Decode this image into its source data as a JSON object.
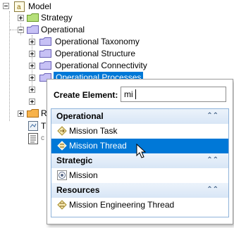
{
  "tree": {
    "root": "Model",
    "items": [
      {
        "label": "Strategy"
      },
      {
        "label": "Operational"
      },
      {
        "label": "Operational Taxonomy"
      },
      {
        "label": "Operational Structure"
      },
      {
        "label": "Operational Connectivity"
      },
      {
        "label": "Operational Processes"
      },
      {
        "label": "R"
      },
      {
        "label": "T"
      },
      {
        "label": "c"
      }
    ]
  },
  "popup": {
    "create_label": "Create Element:",
    "search_value": "mi",
    "groups": [
      {
        "label": "Operational",
        "collapse_icon": "double-chevron-up-icon",
        "items": [
          {
            "label": "Mission Task",
            "icon": "mission-task-icon"
          },
          {
            "label": "Mission Thread",
            "icon": "mission-thread-icon",
            "selected": true
          }
        ]
      },
      {
        "label": "Strategic",
        "collapse_icon": "double-chevron-up-icon",
        "items": [
          {
            "label": "Mission",
            "icon": "mission-icon"
          }
        ]
      },
      {
        "label": "Resources",
        "collapse_icon": "double-chevron-up-icon",
        "items": [
          {
            "label": "Mission Engineering Thread",
            "icon": "mission-engineering-thread-icon"
          }
        ]
      }
    ]
  },
  "colors": {
    "selection": "#0078d7",
    "group_header": "#dde9f7",
    "folder_yellow": "#f5d463",
    "package_purple": "#c7c1f5"
  }
}
